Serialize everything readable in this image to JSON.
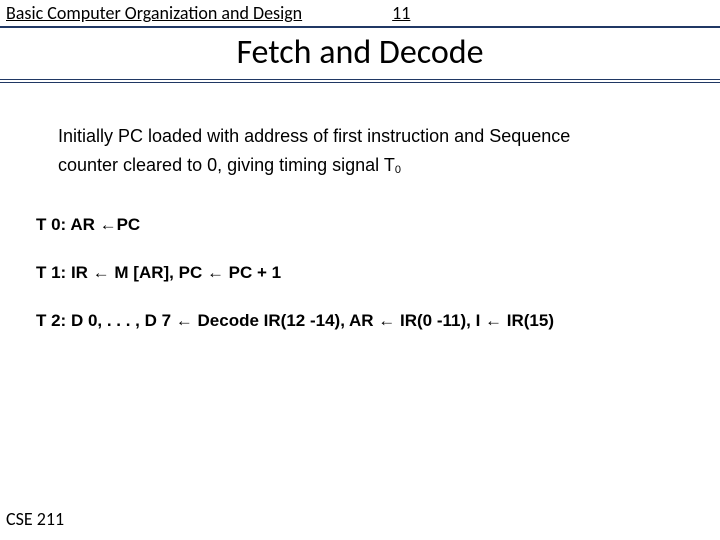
{
  "header": {
    "chapter": "Basic Computer Organization and Design",
    "pagenum": "11"
  },
  "title": "Fetch and Decode",
  "para_line1": "Initially  PC loaded with address of first instruction and Sequence",
  "para_line2_a": "counter cleared to 0, giving timing signal T",
  "para_line2_sub": "0",
  "steps": {
    "t0": "T 0:   AR ←PC",
    "t1": "T 1:   IR ← M [AR],  PC ← PC + 1",
    "t2": "T 2:   D 0, . . . , D 7 ← Decode IR(12 -14), AR ← IR(0 -11), I ← IR(15)"
  },
  "footer": "CSE 211"
}
